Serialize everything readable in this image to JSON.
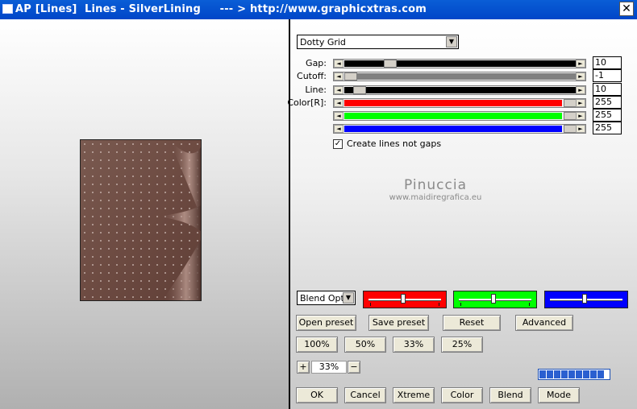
{
  "window": {
    "title": "AP [Lines]  Lines - SilverLining     --- > http://www.graphicxtras.com",
    "close_glyph": "✕"
  },
  "preset_dropdown": {
    "value": "Dotty Grid",
    "arrow": "▼"
  },
  "sliders": [
    {
      "label": "Gap:",
      "value": "10",
      "fill_color": "#000000",
      "level_pct": 18
    },
    {
      "label": "Cutoff:",
      "value": "-1",
      "fill_color": "#808080",
      "level_pct": 0
    },
    {
      "label": "Line:",
      "value": "10",
      "fill_color": "#000000",
      "level_pct": 4
    },
    {
      "label": "Color[R]:",
      "value": "255",
      "fill_color": "#ff0000",
      "level_pct": 100
    },
    {
      "label": "",
      "value": "255",
      "fill_color": "#00ff00",
      "level_pct": 100
    },
    {
      "label": "",
      "value": "255",
      "fill_color": "#0000ff",
      "level_pct": 100
    }
  ],
  "arrows": {
    "left": "◄",
    "right": "►"
  },
  "create_lines_checkbox": {
    "label": "Create lines not gaps",
    "checked": true,
    "mark": "✓"
  },
  "watermark": {
    "name": "Pinuccia",
    "url": "www.maidiregrafica.eu"
  },
  "blend_dropdown": {
    "value": "Blend Optio",
    "arrow": "▼"
  },
  "channel_sliders": [
    {
      "name": "red",
      "color": "#ff0000",
      "level_pct": 50
    },
    {
      "name": "green",
      "color": "#00ff00",
      "level_pct": 50
    },
    {
      "name": "blue",
      "color": "#0000ff",
      "level_pct": 50
    }
  ],
  "buttons_row1": [
    "Open preset",
    "Save preset",
    "Reset",
    "Advanced"
  ],
  "zoom_buttons": [
    "100%",
    "50%",
    "33%",
    "25%"
  ],
  "zoom": {
    "plus": "+",
    "minus": "−",
    "value": "33%"
  },
  "progress_blocks": 9,
  "bottom_buttons": [
    "OK",
    "Cancel",
    "Xtreme",
    "Color",
    "Blend",
    "Mode"
  ]
}
